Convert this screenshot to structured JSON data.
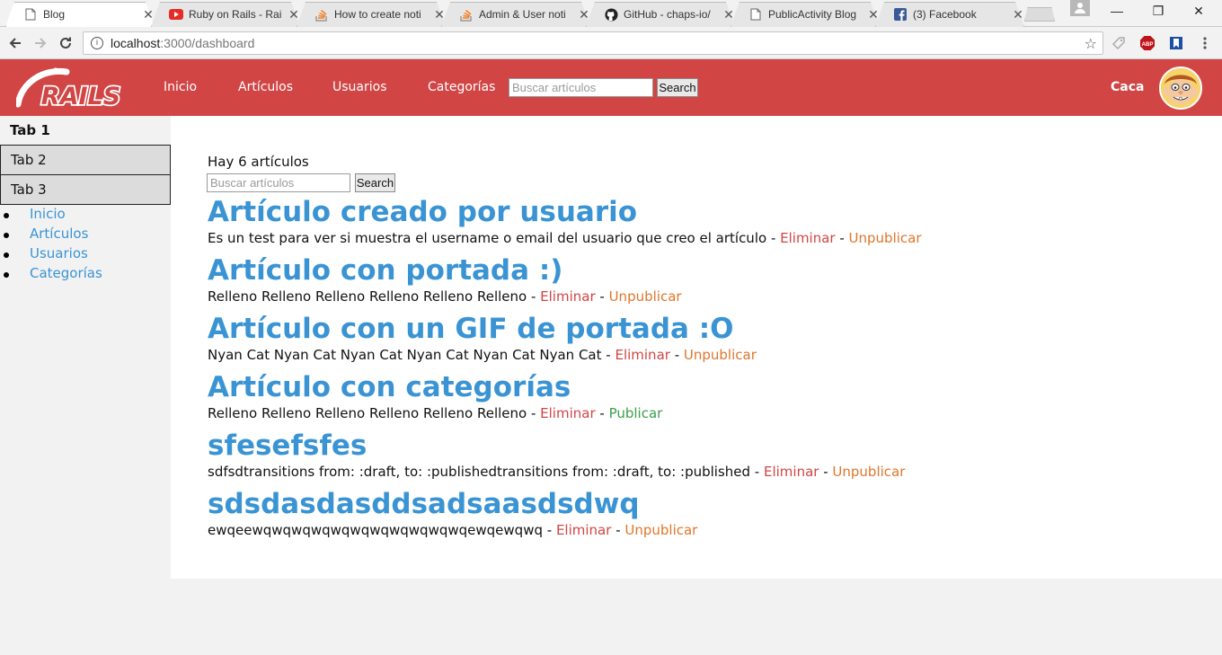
{
  "browser": {
    "tabs": [
      {
        "title": "Blog",
        "icon": "page-icon",
        "active": true
      },
      {
        "title": "Ruby on Rails - Rai",
        "icon": "youtube-icon",
        "active": false
      },
      {
        "title": "How to create noti",
        "icon": "stackoverflow-icon",
        "active": false
      },
      {
        "title": "Admin & User noti",
        "icon": "stackoverflow-icon",
        "active": false
      },
      {
        "title": "GitHub - chaps-io/",
        "icon": "github-icon",
        "active": false
      },
      {
        "title": "PublicActivity Blog",
        "icon": "page-icon",
        "active": false
      },
      {
        "title": "(3) Facebook",
        "icon": "facebook-icon",
        "active": false
      }
    ],
    "url_host": "localhost",
    "url_path": ":3000/dashboard",
    "window_controls": {
      "minimize": "—",
      "restore": "❐",
      "close": "✕"
    }
  },
  "header": {
    "logo_text": "RAILS",
    "nav": [
      "Inicio",
      "Artículos",
      "Usuarios",
      "Categorías"
    ],
    "search_placeholder": "Buscar artículos",
    "search_button": "Search",
    "username": "Caca"
  },
  "sidebar": {
    "tabs": [
      "Tab 1",
      "Tab 2",
      "Tab 3"
    ],
    "links": [
      "Inicio",
      "Artículos",
      "Usuarios",
      "Categorías"
    ]
  },
  "main": {
    "count_text": "Hay 6 artículos",
    "search_placeholder": "Buscar artículos",
    "search_button": "Search",
    "separator": " - ",
    "articles": [
      {
        "title": "Artículo creado por usuario",
        "body": "Es un test para ver si muestra el username o email del usuario que creo el artículo",
        "delete": "Eliminar",
        "toggle": "Unpublicar",
        "toggle_kind": "unpublish"
      },
      {
        "title": "Artículo con portada :)",
        "body": "Relleno Relleno Relleno Relleno Relleno Relleno",
        "delete": "Eliminar",
        "toggle": "Unpublicar",
        "toggle_kind": "unpublish"
      },
      {
        "title": "Artículo con un GIF de portada :O",
        "body": "Nyan Cat Nyan Cat Nyan Cat Nyan Cat Nyan Cat Nyan Cat",
        "delete": "Eliminar",
        "toggle": "Unpublicar",
        "toggle_kind": "unpublish"
      },
      {
        "title": "Artículo con categorías",
        "body": "Relleno Relleno Relleno Relleno Relleno Relleno",
        "delete": "Eliminar",
        "toggle": "Publicar",
        "toggle_kind": "publish"
      },
      {
        "title": "sfesefsfes",
        "body": "sdfsdtransitions from: :draft, to: :publishedtransitions from: :draft, to: :published",
        "delete": "Eliminar",
        "toggle": "Unpublicar",
        "toggle_kind": "unpublish"
      },
      {
        "title": "sdsdasdasddsadsaasdsdwq",
        "body": "ewqeewqwqwqwqwqwqwqwqwqwqwqewqewqwq",
        "delete": "Eliminar",
        "toggle": "Unpublicar",
        "toggle_kind": "unpublish"
      }
    ]
  },
  "colors": {
    "brand_red": "#d14545",
    "link_blue": "#3a94d4",
    "delete_red": "#d14545",
    "unpublish_orange": "#e0762b",
    "publish_green": "#3b9e4a"
  }
}
